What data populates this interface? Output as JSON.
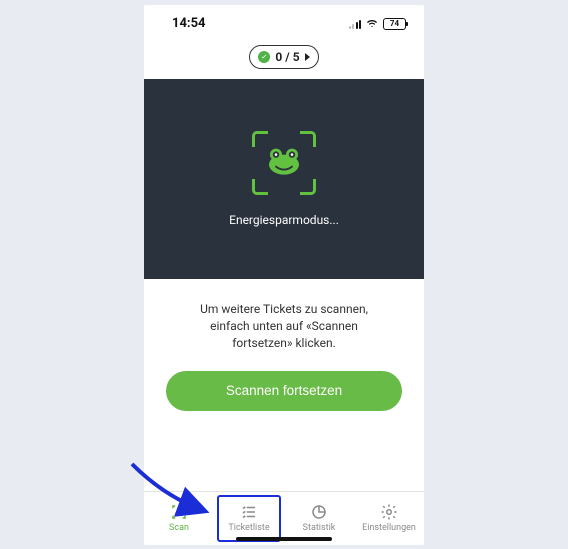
{
  "status": {
    "time": "14:54",
    "battery_pct": "74"
  },
  "counter": {
    "value": "0 / 5"
  },
  "panel": {
    "status_text": "Energiesparmodus..."
  },
  "info": {
    "line1": "Um weitere Tickets zu scannen,",
    "line2": "einfach unten auf «Scannen",
    "line3": "fortsetzen» klicken."
  },
  "resume_button": {
    "label": "Scannen fortsetzen"
  },
  "tabs": {
    "scan": "Scan",
    "ticketlist": "Ticketliste",
    "stats": "Statistik",
    "settings": "Einstellungen"
  }
}
